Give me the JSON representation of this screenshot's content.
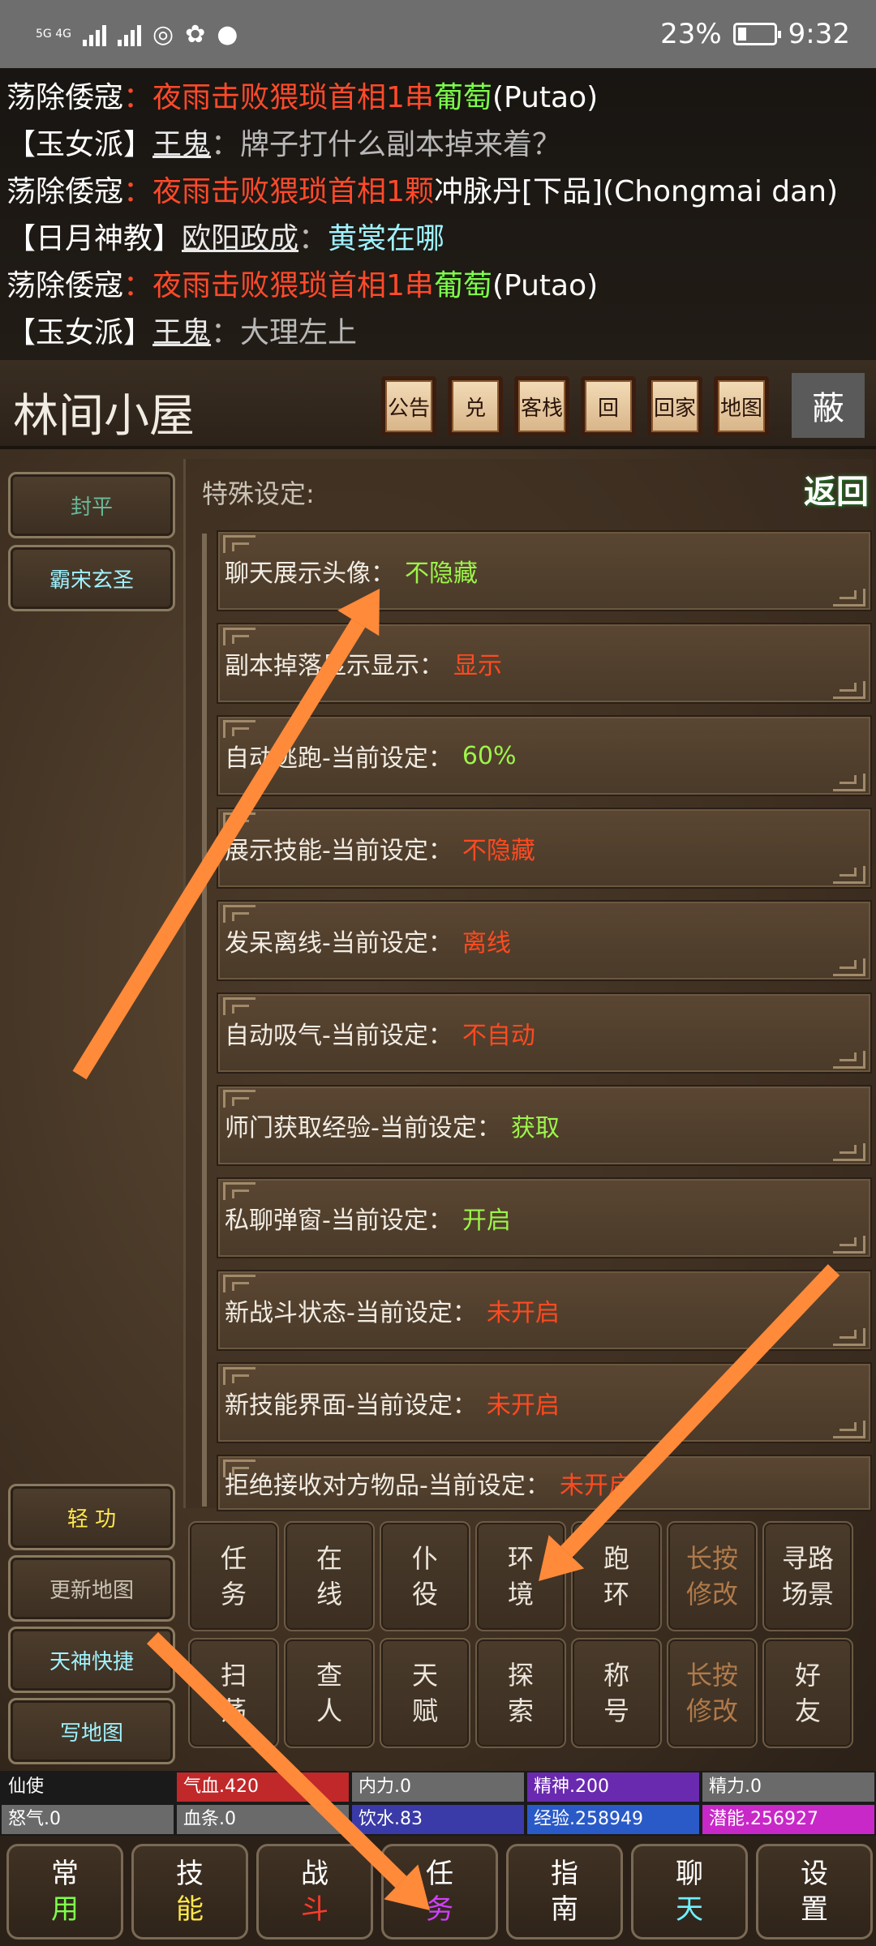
{
  "status_bar": {
    "network": "5G 4G",
    "battery": "23%",
    "time": "9:32"
  },
  "chat": [
    {
      "channel": "荡除倭寇",
      "sep": "：",
      "parts": [
        {
          "t": "夜雨击败猥琐首相1串",
          "c": "red"
        },
        {
          "t": "葡萄",
          "c": "green"
        },
        {
          "t": "(Putao)",
          "c": "white"
        }
      ]
    },
    {
      "channel": "【玉女派】",
      "name": "王鬼",
      "sep": "：",
      "parts": [
        {
          "t": "牌子打什么副本掉来着？",
          "c": "grey"
        }
      ]
    },
    {
      "channel": "荡除倭寇",
      "sep": "：",
      "parts": [
        {
          "t": "夜雨击败猥琐首相1颗",
          "c": "red"
        },
        {
          "t": "冲脉丹[下品](Chongmai dan)",
          "c": "white"
        }
      ]
    },
    {
      "channel": "【日月神教】",
      "name": "欧阳政成",
      "sep": "：",
      "parts": [
        {
          "t": "黄裳在哪",
          "c": "cyan"
        }
      ]
    },
    {
      "channel": "荡除倭寇",
      "sep": "：",
      "parts": [
        {
          "t": "夜雨击败猥琐首相1串",
          "c": "red"
        },
        {
          "t": "葡萄",
          "c": "green"
        },
        {
          "t": "(Putao)",
          "c": "white"
        }
      ]
    },
    {
      "channel": "【玉女派】",
      "name": "王鬼",
      "sep": "：",
      "parts": [
        {
          "t": "大理左上",
          "c": "grey"
        }
      ]
    }
  ],
  "location": {
    "title": "林间小屋",
    "buttons": [
      "公告",
      "兑",
      "客栈",
      "回",
      "回家",
      "地图"
    ],
    "hide_label": "蔽"
  },
  "left_top_buttons": [
    "封平",
    "霸宋玄圣"
  ],
  "left_bottom_buttons": [
    "轻 功",
    "更新地图",
    "天神快捷",
    "写地图"
  ],
  "panel": {
    "title": "特殊设定:",
    "return_label": "返回",
    "settings": [
      {
        "label": "聊天展示头像：",
        "value": "不隐藏",
        "color": "green"
      },
      {
        "label": "副本掉落显示显示：",
        "value": "显示",
        "color": "red"
      },
      {
        "label": "自动逃跑-当前设定：",
        "value": "60%",
        "color": "green"
      },
      {
        "label": "展示技能-当前设定：",
        "value": "不隐藏",
        "color": "red"
      },
      {
        "label": "发呆离线-当前设定：",
        "value": "离线",
        "color": "red"
      },
      {
        "label": "自动吸气-当前设定：",
        "value": "不自动",
        "color": "red"
      },
      {
        "label": "师门获取经验-当前设定：",
        "value": "获取",
        "color": "green"
      },
      {
        "label": "私聊弹窗-当前设定：",
        "value": "开启",
        "color": "green"
      },
      {
        "label": "新战斗状态-当前设定：",
        "value": "未开启",
        "color": "red"
      },
      {
        "label": "新技能界面-当前设定：",
        "value": "未开启",
        "color": "red"
      },
      {
        "label": "拒绝接收对方物品-当前设定：",
        "value": "未开启",
        "color": "red"
      }
    ]
  },
  "grid_buttons": [
    [
      "任",
      "务"
    ],
    [
      "在",
      "线"
    ],
    [
      "仆",
      "役"
    ],
    [
      "环",
      "境"
    ],
    [
      "跑",
      "环"
    ],
    [
      "长按",
      "修改"
    ],
    [
      "寻路",
      "场景"
    ],
    [
      "扫",
      "荡"
    ],
    [
      "查",
      "人"
    ],
    [
      "天",
      "赋"
    ],
    [
      "探",
      "索"
    ],
    [
      "称",
      "号"
    ],
    [
      "长按",
      "修改"
    ],
    [
      "好",
      "友"
    ]
  ],
  "stats": [
    {
      "text": "仙使",
      "bg": "#1a1a1a"
    },
    {
      "text": "气血.420",
      "bg": "#c0282a"
    },
    {
      "text": "内力.0",
      "bg": "#6a6a6a"
    },
    {
      "text": "精神.200",
      "bg": "#6a2ab0"
    },
    {
      "text": "精力.0",
      "bg": "#6a6a6a"
    },
    {
      "text": "怒气.0",
      "bg": "#6a6a6a"
    },
    {
      "text": "血条.0",
      "bg": "#6a6a6a"
    },
    {
      "text": "饮水.83",
      "bg": "#3a3aa8"
    },
    {
      "text": "经验.258949",
      "bg": "#2a5ac8"
    },
    {
      "text": "潜能.256927",
      "bg": "#c828c8"
    }
  ],
  "nav": [
    {
      "top": "常",
      "bottom": "用",
      "color": "#7dff4a"
    },
    {
      "top": "技",
      "bottom": "能",
      "color": "#ffe84a"
    },
    {
      "top": "战",
      "bottom": "斗",
      "color": "#ff3a2a"
    },
    {
      "top": "任",
      "bottom": "务",
      "color": "#d040ff"
    },
    {
      "top": "指",
      "bottom": "南",
      "color": "#ffffff"
    },
    {
      "top": "聊",
      "bottom": "天",
      "color": "#6ff0ff"
    },
    {
      "top": "设",
      "bottom": "置",
      "color": "#ffffff"
    }
  ],
  "colors": {
    "arrow": "#ff8a3a"
  }
}
